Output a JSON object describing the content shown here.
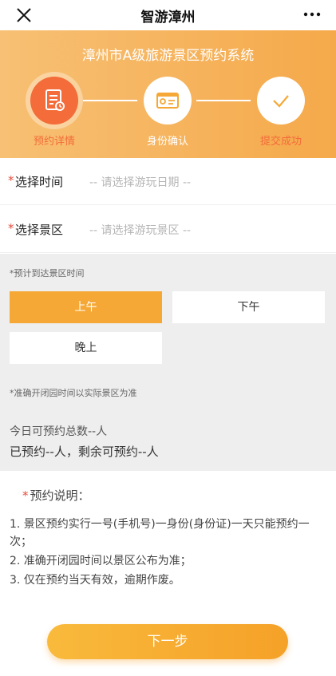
{
  "topbar": {
    "title": "智游漳州",
    "close_icon": "close-icon",
    "more_icon": "more-dots-icon"
  },
  "header": {
    "system_title": "漳州市A级旅游景区预约系统",
    "steps": [
      {
        "label": "预约详情",
        "icon": "document-icon",
        "state": "active"
      },
      {
        "label": "身份确认",
        "icon": "id-card-icon",
        "state": "pending"
      },
      {
        "label": "提交成功",
        "icon": "checkmark-icon",
        "state": "pending"
      }
    ],
    "colors": {
      "gradient_start": "#f7c074",
      "gradient_end": "#f5a94a",
      "active_step": "#f36c3a"
    }
  },
  "form": {
    "date": {
      "required_mark": "*",
      "label": "选择时间",
      "placeholder": "-- 请选择游玩日期 --"
    },
    "scenic": {
      "required_mark": "*",
      "label": "选择景区",
      "placeholder": "-- 请选择游玩景区 --"
    }
  },
  "arrival": {
    "hint": "*预计到达景区时间",
    "slots": [
      {
        "label": "上午",
        "selected": true
      },
      {
        "label": "下午",
        "selected": false
      },
      {
        "label": "晚上",
        "selected": false
      }
    ],
    "note": "*准确开闭园时间以实际景区为准"
  },
  "quota": {
    "total": "今日可预约总数--人",
    "booked": "已预约--人，剩余可预约--人"
  },
  "notes": {
    "required_mark": "*",
    "title": "预约说明：",
    "items": [
      "1. 景区预约实行一号(手机号)一身份(身份证)一天只能预约一次；",
      "2. 准确开闭园时间以景区公布为准；",
      "3. 仅在预约当天有效，逾期作废。"
    ]
  },
  "footer": {
    "next_label": "下一步",
    "accent": "#f5a836"
  }
}
